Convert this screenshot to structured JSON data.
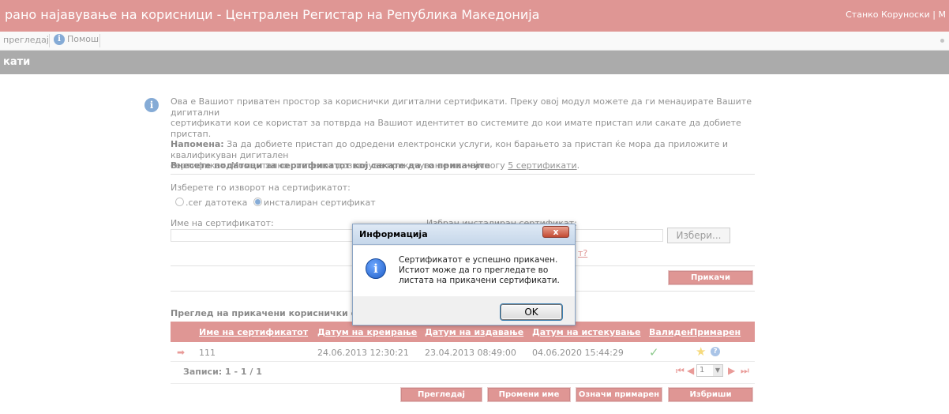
{
  "window": {
    "title": "рано најавување на корисници - Централен Регистар на Република Македонија",
    "user": "Станко Коруноски | М"
  },
  "menu": {
    "items": [
      {
        "label": "прегледај"
      },
      {
        "label": "Помош"
      }
    ]
  },
  "section": {
    "title": "кати"
  },
  "intro": {
    "line1": "Ова е Вашиот приватен простор за кориснички дигитални сертификати. Преку овој модул можете да ги менаџирате Вашите дигитални",
    "line2": "сертификати кои се користат за потврда на Вашиот идентитет во системите до кои имате пристап или сакате да добиете пристап.",
    "note_label": "Напомена:",
    "note_text": " За да добиете пристап до одредени електронски услуги, кон барањето за пристап ќе мора да приложите и квалификуван дигитален",
    "line4": "сертификат. Моментално системот дозволува прикачување на најмногу ",
    "limit_link": "5 сертификати",
    "line4_end": "."
  },
  "form": {
    "heading": "Внесете податоци за сертификатот кој сакате да го прикачите",
    "source_label": "Изберете го изворот на сертификатот:",
    "radio_cer": ".cer датотека",
    "radio_installed": "инсталиран сертификат",
    "radio_selected": "installed",
    "name_label": "Име на сертификатот:",
    "installed_label": "Избран инсталиран сертификат:",
    "browse_button": "Избери...",
    "help_link": "т?",
    "attach_button": "Прикачи"
  },
  "list": {
    "heading": "Преглед на прикачени кориснички сертиф",
    "columns": [
      "Име на сертификатот",
      "Датум на креирање",
      "Датум на издавање",
      "Датум на истекување",
      "Валиден",
      "Примарен"
    ],
    "rows": [
      {
        "name": "111",
        "created": "24.06.2013 12:30:21",
        "issued": "23.04.2013 08:49:00",
        "expires": "04.06.2020 15:44:29",
        "valid": true,
        "primary": true
      }
    ],
    "records_label": "Записи: 1 - 1 / 1",
    "page_value": "1",
    "buttons": {
      "view": "Прегледај",
      "rename": "Промени име",
      "set_primary": "Означи примарен",
      "delete": "Избриши"
    }
  },
  "dialog": {
    "title": "Информација",
    "close": "x",
    "message": "Сертификатот е успешно прикачен. Истиот може да го прегледате во листата на прикачени сертификати.",
    "ok_button": "OK"
  },
  "colors": {
    "brand_red": "#c94a48",
    "section_gray": "#6f6f6f",
    "info_blue": "#2e6fb8"
  },
  "icons": {
    "help": "info-icon",
    "intro": "info-icon",
    "row_marker": "arrow-right-icon",
    "valid": "checkmark-icon",
    "primary": "star-icon",
    "primary_help": "question-icon",
    "pager": [
      "first-page-icon",
      "prev-page-icon",
      "next-page-icon",
      "last-page-icon"
    ],
    "dialog": "info-icon",
    "dialog_close": "close-icon"
  }
}
